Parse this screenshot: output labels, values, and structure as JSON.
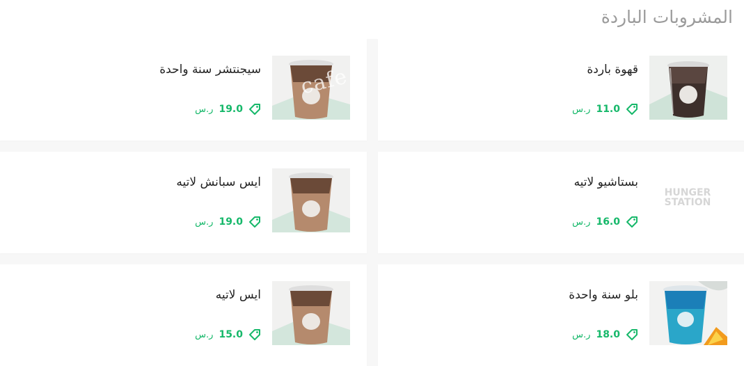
{
  "section": {
    "title": "المشروبات الباردة"
  },
  "watermark_text": "cafe",
  "products": {
    "cold_coffee": {
      "name": "قهوة باردة",
      "price": "11.0",
      "currency": "ر.س",
      "image": "iced-coffee-cup"
    },
    "signature": {
      "name": "سيجنتشر سنة واحدة",
      "price": "19.0",
      "currency": "ر.س",
      "image": "iced-latte-cup"
    },
    "pistachio": {
      "name": "بستاشيو لاتيه",
      "price": "16.0",
      "currency": "ر.س",
      "image": "placeholder-logo",
      "logo_line1": "HUNGER",
      "logo_line2": "STATION"
    },
    "spanish": {
      "name": "ايس سبانش لاتيه",
      "price": "19.0",
      "currency": "ر.س",
      "image": "iced-latte-cup"
    },
    "blue": {
      "name": "بلو سنة واحدة",
      "price": "18.0",
      "currency": "ر.س",
      "image": "blue-drink-cup"
    },
    "ice_latte": {
      "name": "ايس لاتيه",
      "price": "15.0",
      "currency": "ر.س",
      "image": "iced-latte-cup"
    }
  },
  "icons": {
    "price": "price-tag-icon"
  },
  "colors": {
    "accent": "#16b86a",
    "title": "#9b9b9b",
    "text": "#222222",
    "background": "#f7f7f7"
  }
}
